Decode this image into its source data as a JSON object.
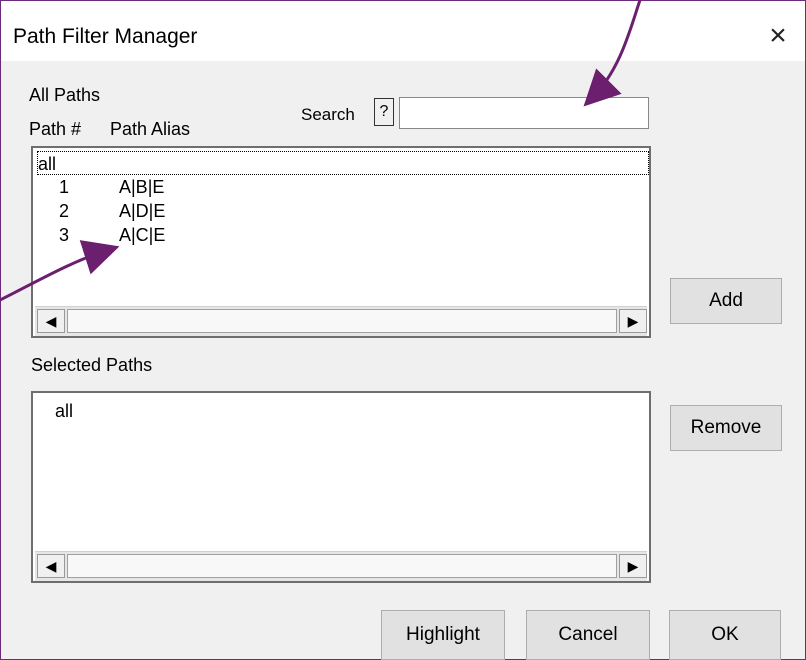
{
  "dialog": {
    "title": "Path Filter Manager"
  },
  "icons": {
    "close": "×",
    "scroll_left": "◀",
    "scroll_right": "▶"
  },
  "colors": {
    "annotation_arrow": "#6b1f6e"
  },
  "all_paths": {
    "section_label": "All Paths",
    "col_num_header": "Path #",
    "col_alias_header": "Path Alias",
    "items": [
      {
        "num": "all",
        "alias": ""
      },
      {
        "num": "1",
        "alias": "A|B|E"
      },
      {
        "num": "2",
        "alias": "A|D|E"
      },
      {
        "num": "3",
        "alias": "A|C|E"
      }
    ]
  },
  "search": {
    "label": "Search",
    "help_label": "?",
    "value": "",
    "placeholder": ""
  },
  "selected_paths": {
    "section_label": "Selected Paths",
    "items": [
      {
        "label": "all"
      }
    ]
  },
  "buttons": {
    "add": "Add",
    "remove": "Remove",
    "highlight": "Highlight",
    "cancel": "Cancel",
    "ok": "OK"
  }
}
